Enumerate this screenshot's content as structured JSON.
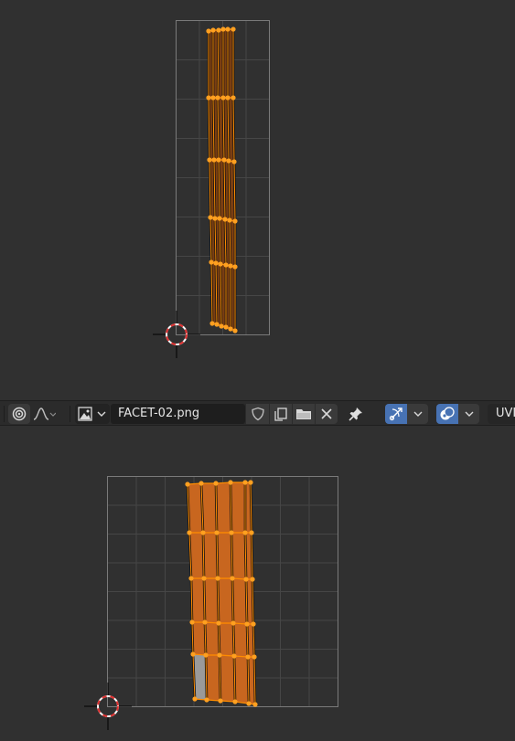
{
  "header": {
    "image_name": "FACET-02.png",
    "mode_label": "UVI",
    "icons": {
      "proportional": "proportional-editing-icon",
      "falloff": "falloff-curve-icon",
      "image_type": "image-browse-icon",
      "fake_user": "fake-user-shield-icon",
      "new_image": "new-image-icon",
      "open_image": "open-image-folder-icon",
      "unlink": "unlink-x-icon",
      "pin": "pin-icon",
      "sticky_select": "uv-sync-select-icon",
      "overlay": "overlay-icon"
    }
  },
  "colors": {
    "background": "#303030",
    "header": "#2b2b2b",
    "accent_blue": "#4772b3",
    "uv_edge": "#ff8c00",
    "uv_face": "#c8661f",
    "grid": "#4a4a4a"
  }
}
